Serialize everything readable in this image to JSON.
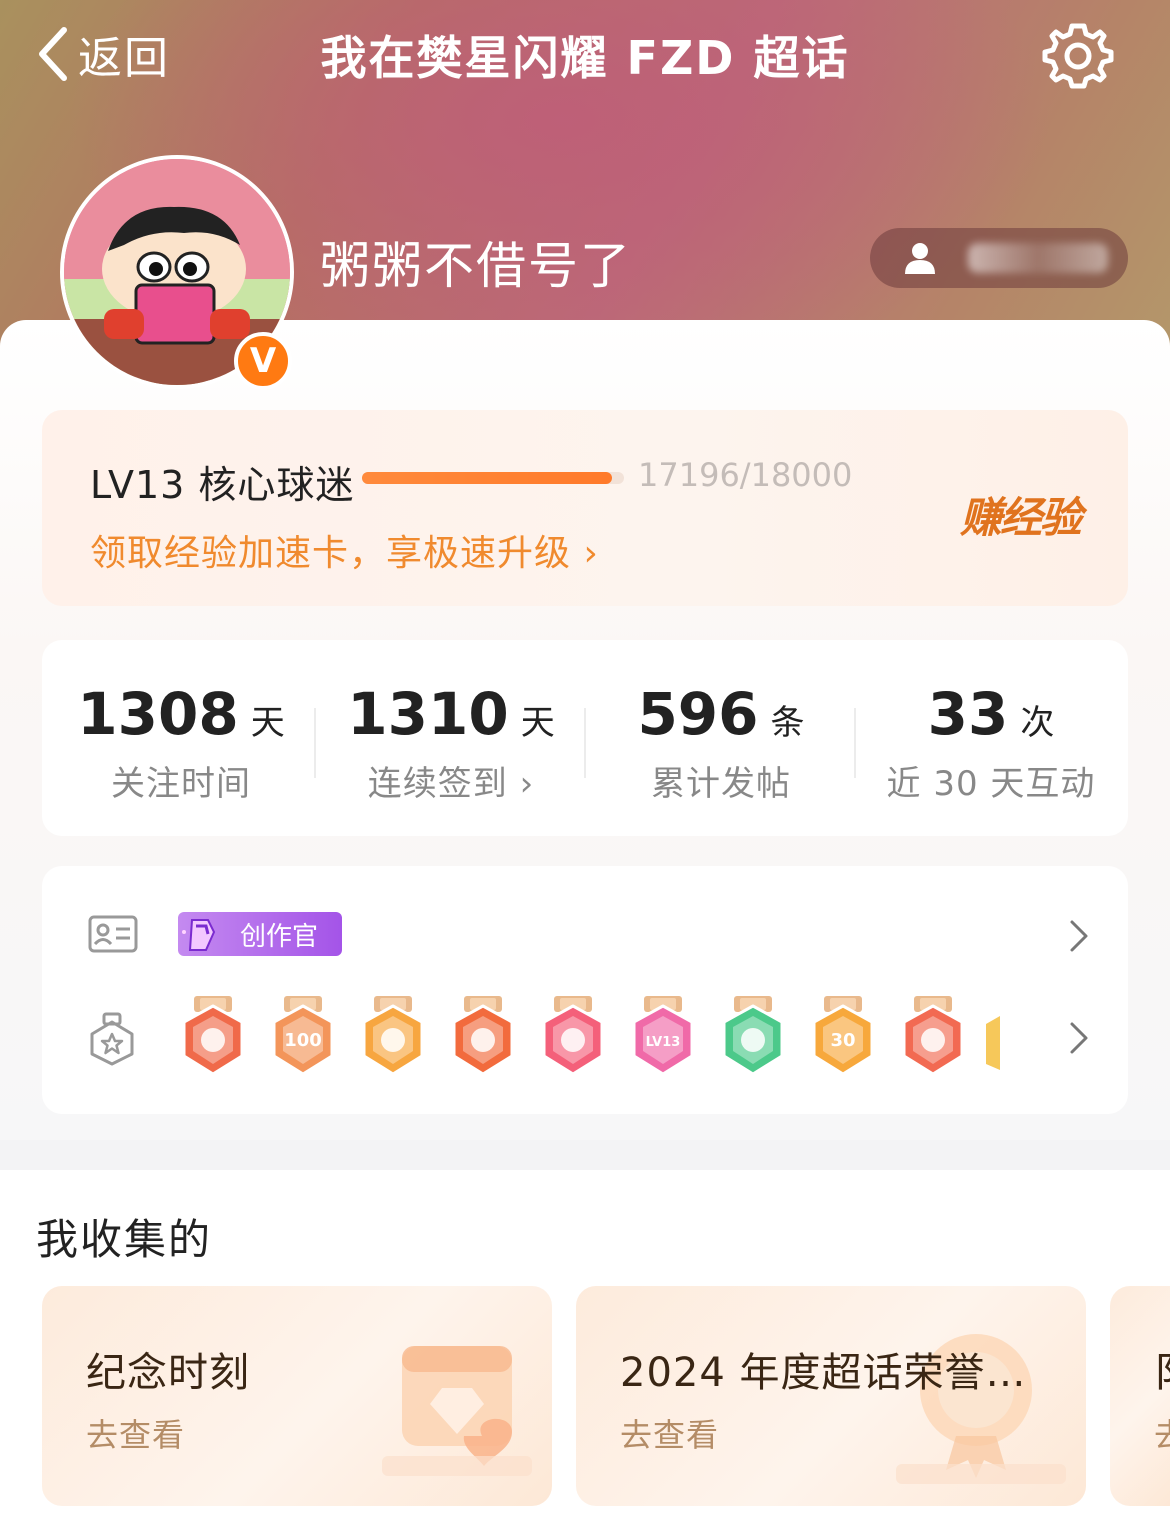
{
  "header": {
    "back_label": "返回",
    "title": "我在樊星闪耀 FZD 超话"
  },
  "profile": {
    "username": "粥粥不借号了",
    "verified_mark": "V"
  },
  "level": {
    "label": "LV13 核心球迷",
    "progress_text": "17196/18000",
    "progress_fraction": 0.955,
    "promo": "领取经验加速卡，享极速升级 ›",
    "earn_button": "赚经验"
  },
  "stats": [
    {
      "value": "1308",
      "unit": "天",
      "label": "关注时间"
    },
    {
      "value": "1310",
      "unit": "天",
      "label": "连续签到 ›"
    },
    {
      "value": "596",
      "unit": "条",
      "label": "累计发帖"
    },
    {
      "value": "33",
      "unit": "次",
      "label": "近 30 天互动"
    }
  ],
  "badges": {
    "creator_tag": "创作官",
    "medals": [
      {
        "icon": "cat-medal",
        "color": "#f06a4a"
      },
      {
        "icon": "100-days-medal",
        "color": "#f3955a",
        "text": "100"
      },
      {
        "icon": "crown-medal",
        "color": "#f7a640"
      },
      {
        "icon": "dragon-medal",
        "color": "#f26b3d"
      },
      {
        "icon": "rabbit-medal",
        "color": "#f4607a"
      },
      {
        "icon": "lv13-medal",
        "color": "#f06aa8",
        "text": "LV13"
      },
      {
        "icon": "hand-medal",
        "color": "#4cc98a"
      },
      {
        "icon": "30-days-medal",
        "color": "#f7a83c",
        "text": "30"
      },
      {
        "icon": "rock-hand-medal",
        "color": "#f26a52"
      }
    ]
  },
  "collection": {
    "title": "我收集的",
    "cards": [
      {
        "title": "纪念时刻",
        "action": "去查看"
      },
      {
        "title": "2024 年度超话荣誉…",
        "action": "去查看"
      },
      {
        "title": "阝",
        "action": "去"
      }
    ]
  }
}
